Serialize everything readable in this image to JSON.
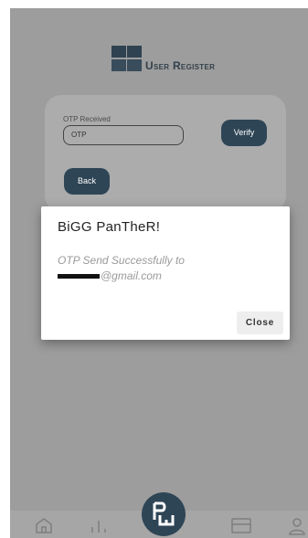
{
  "header": {
    "title_first": "User",
    "title_second": "Register"
  },
  "form": {
    "otp_label": "OTP Received",
    "otp_placeholder": "OTP",
    "verify_label": "Verify",
    "back_label": "Back"
  },
  "dialog": {
    "title": "BiGG PanTheR!",
    "message_line1": "OTP Send Successfully to",
    "message_email_suffix": "@gmail.com",
    "close_label": "Close"
  },
  "nav": {
    "items": [
      {
        "icon": "home-icon"
      },
      {
        "icon": "bar-chart-icon"
      },
      {
        "icon": "app-logo-icon"
      },
      {
        "icon": "card-icon"
      },
      {
        "icon": "profile-icon"
      }
    ]
  },
  "colors": {
    "overlay": "#9d9d9d",
    "card": "#acacac",
    "primary_button": "#2e4556",
    "dialog_bg": "#ffffff"
  }
}
